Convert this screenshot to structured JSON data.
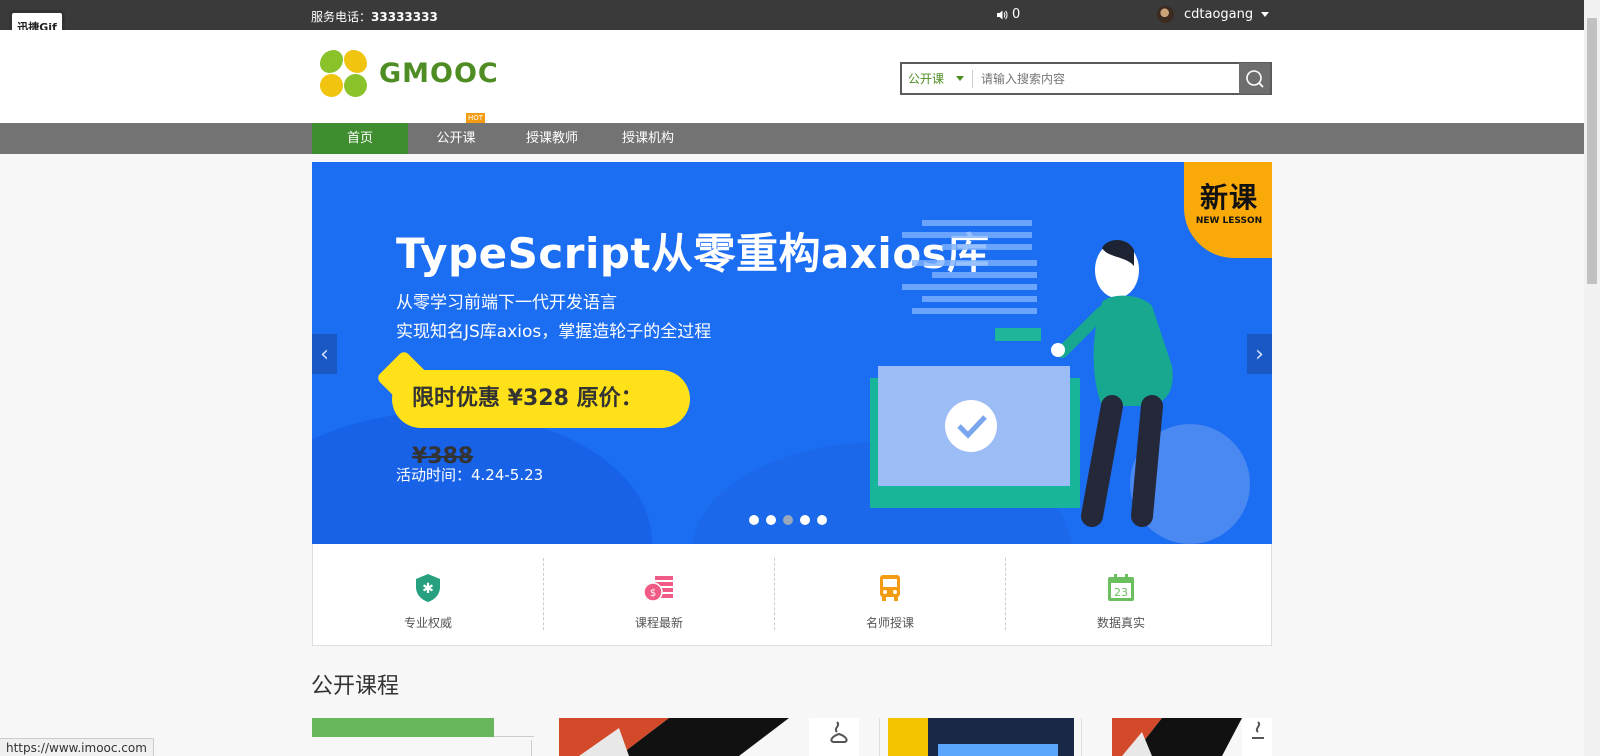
{
  "topbar": {
    "phone_label": "服务电话：",
    "phone_number": "33333333",
    "messages_count": "0",
    "username": "cdtaogang"
  },
  "gif_badge": "迅捷Gif",
  "logo": {
    "text": "GMOOC"
  },
  "search": {
    "category": "公开课",
    "placeholder": "请输入搜索内容"
  },
  "nav": {
    "items": [
      {
        "label": "首页",
        "active": true
      },
      {
        "label": "公开课",
        "badge": "HOT"
      },
      {
        "label": "授课教师"
      },
      {
        "label": "授课机构"
      }
    ]
  },
  "banner": {
    "title": "TypeScript从零重构axios库",
    "sub1": "从零学习前端下一代开发语言",
    "sub2": "实现知名JS库axios，掌握造轮子的全过程",
    "price_promo": "限时优惠 ¥328",
    "price_orig_label": "原价：",
    "price_orig_value": "¥388",
    "date": "活动时间：4.24-5.23",
    "badge_zh": "新课",
    "badge_en": "NEW LESSON",
    "prev": "‹",
    "next": "›",
    "dots_count": 5,
    "active_dot": 3
  },
  "features": [
    {
      "label": "专业权威",
      "icon": "shield-star-icon",
      "color": "#26a07f"
    },
    {
      "label": "课程最新",
      "icon": "coins-icon",
      "color": "#ef5b84"
    },
    {
      "label": "名师授课",
      "icon": "bus-icon",
      "color": "#f39c12"
    },
    {
      "label": "数据真实",
      "icon": "calendar-icon",
      "color": "#6bbf5f",
      "day": "23"
    }
  ],
  "section": {
    "title": "公开课程"
  },
  "statusbar": {
    "url": "https://www.imooc.com"
  }
}
